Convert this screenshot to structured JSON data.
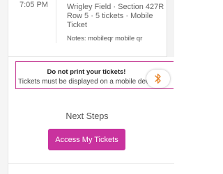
{
  "ticket": {
    "time": "7:05 PM",
    "venue": "Wrigley Field · Section 427R",
    "seats": "Row 5 · 5 tickets · Mobile",
    "delivery": "Ticket",
    "notes": "Notes: mobileqr mobile qr"
  },
  "notice": {
    "title": "Do not print your tickets!",
    "body": "Tickets must be displayed on a mobile device"
  },
  "badge": {
    "icon": "bluetooth-icon",
    "color": "#e8862c"
  },
  "next_steps": {
    "heading": "Next Steps",
    "button_label": "Access My Tickets"
  },
  "colors": {
    "accent": "#c9329e",
    "notice_border": "#c74397"
  }
}
